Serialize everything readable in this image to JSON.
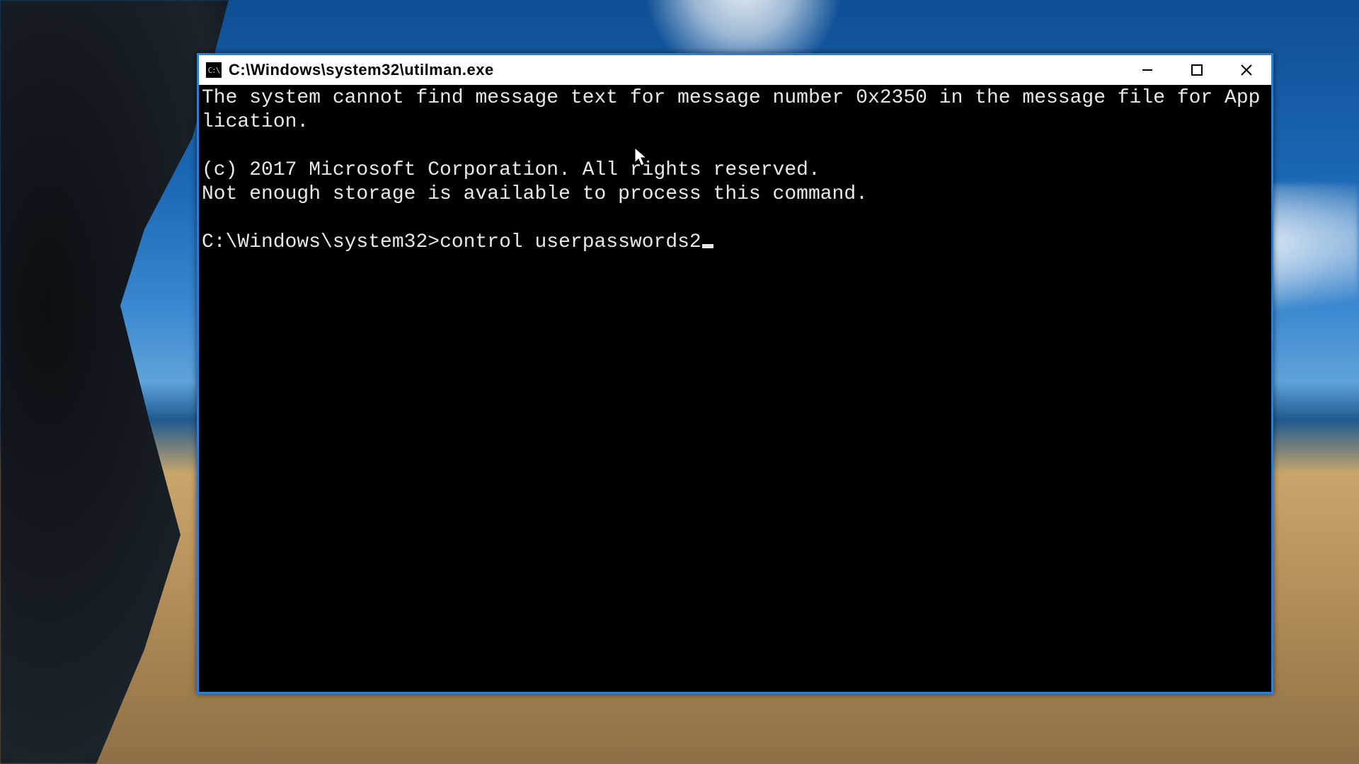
{
  "window": {
    "title": "C:\\Windows\\system32\\utilman.exe",
    "icon_label": "cmd-icon"
  },
  "console": {
    "line1": "The system cannot find message text for message number 0x2350 in the message file for Application.",
    "line2": "(c) 2017 Microsoft Corporation. All rights reserved.",
    "line3": "Not enough storage is available to process this command.",
    "prompt_path": "C:\\Windows\\system32>",
    "typed_command": "control userpasswords2"
  }
}
